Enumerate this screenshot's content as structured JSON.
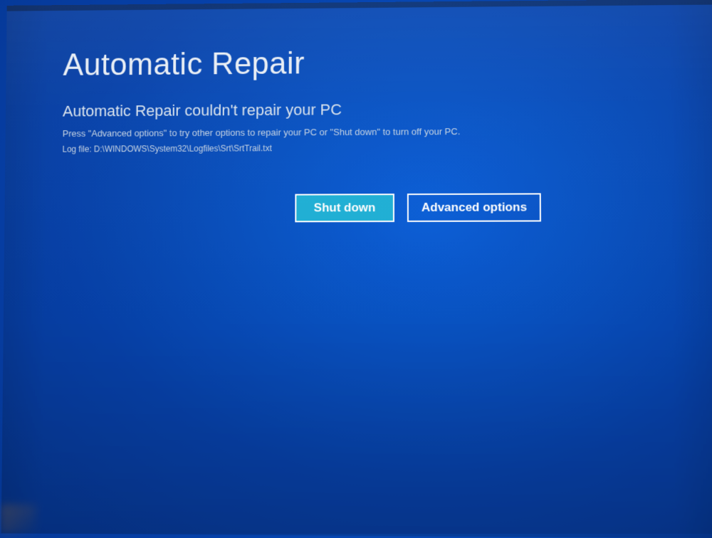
{
  "title": "Automatic Repair",
  "subtitle": "Automatic Repair couldn't repair your PC",
  "instruction": "Press \"Advanced options\" to try other options to repair your PC or \"Shut down\" to turn off your PC.",
  "logfile": "Log file: D:\\WINDOWS\\System32\\Logfiles\\Srt\\SrtTrail.txt",
  "buttons": {
    "shutdown_label": "Shut down",
    "advanced_label": "Advanced options"
  }
}
